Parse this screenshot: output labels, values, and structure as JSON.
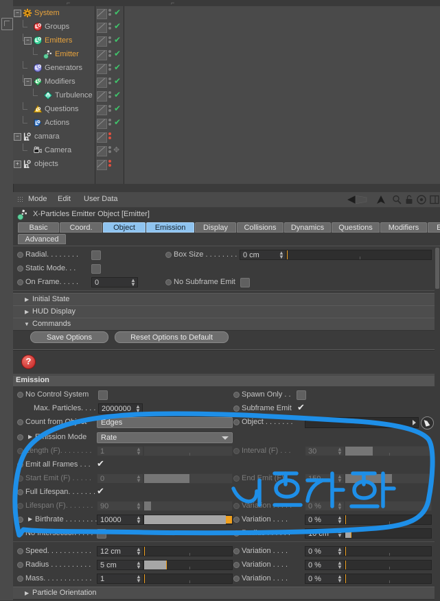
{
  "object_manager": {
    "tree": [
      {
        "label": "System",
        "icon": "gear-icon",
        "color": "orange",
        "depth": 0,
        "expander": "minus",
        "visible_chk": true,
        "dots": "grey"
      },
      {
        "label": "Groups",
        "icon": "group-icon",
        "color": "grey",
        "depth": 1,
        "expander": "none",
        "visible_chk": true,
        "dots": "grey"
      },
      {
        "label": "Emitters",
        "icon": "emitters-icon",
        "color": "orange",
        "depth": 1,
        "expander": "minus",
        "visible_chk": true,
        "dots": "grey"
      },
      {
        "label": "Emitter",
        "icon": "particle-emitter-icon",
        "color": "orange",
        "depth": 2,
        "expander": "none",
        "visible_chk": true,
        "dots": "grey"
      },
      {
        "label": "Generators",
        "icon": "generators-icon",
        "color": "grey",
        "depth": 1,
        "expander": "none",
        "visible_chk": true,
        "dots": "grey"
      },
      {
        "label": "Modifiers",
        "icon": "modifiers-icon",
        "color": "grey",
        "depth": 1,
        "expander": "minus",
        "visible_chk": true,
        "dots": "grey"
      },
      {
        "label": "Turbulence",
        "icon": "turbulence-icon",
        "color": "grey",
        "depth": 2,
        "expander": "none",
        "visible_chk": true,
        "dots": "grey"
      },
      {
        "label": "Questions",
        "icon": "questions-icon",
        "color": "grey",
        "depth": 1,
        "expander": "none",
        "visible_chk": true,
        "dots": "grey"
      },
      {
        "label": "Actions",
        "icon": "actions-icon",
        "color": "grey",
        "depth": 1,
        "expander": "none",
        "visible_chk": true,
        "dots": "grey"
      },
      {
        "label": "camara",
        "icon": "null-object-icon",
        "color": "grey",
        "depth": 0,
        "expander": "minus",
        "visible_chk": false,
        "dots": "red"
      },
      {
        "label": "Camera",
        "icon": "camera-icon",
        "color": "grey",
        "depth": 1,
        "expander": "none",
        "visible_chk": false,
        "dots": "grey"
      },
      {
        "label": "objects",
        "icon": "null-object-icon",
        "color": "grey",
        "depth": 0,
        "expander": "plus",
        "visible_chk": false,
        "dots": "red"
      }
    ]
  },
  "attribute_manager": {
    "menu": [
      "Mode",
      "Edit",
      "User Data"
    ],
    "toolbar_icons": [
      "back-arrow-icon",
      "up-arrow-icon",
      "search-icon",
      "lock-icon",
      "target-icon",
      "panel-icon"
    ],
    "title": "X-Particles Emitter Object [Emitter]",
    "title_icon": "particle-emitter-icon",
    "tabs_row1": [
      "Basic",
      "Coord.",
      "Object",
      "Emission",
      "Display",
      "Collisions",
      "Dynamics",
      "Questions",
      "Modifiers",
      "Editing"
    ],
    "tabs_row2": [
      "Advanced"
    ],
    "selected_tabs": [
      "Object",
      "Emission"
    ]
  },
  "object_tab": {
    "radial": {
      "label": "Radial. . . . . . . .",
      "checked": false
    },
    "static_mode": {
      "label": "Static Mode. . .",
      "checked": false
    },
    "on_frame": {
      "label": "On Frame. . . . .",
      "value": "0"
    },
    "box_size": {
      "label": "Box Size . . . . . . . .",
      "value": "0 cm"
    },
    "no_subframe_emit": {
      "label": "No Subframe Emit",
      "checked": false
    },
    "sections": [
      "Initial State",
      "HUD Display",
      "Commands"
    ],
    "commands": {
      "save_options": "Save Options",
      "reset_options": "Reset Options to Default"
    }
  },
  "emission": {
    "header": "Emission",
    "no_control_system": {
      "label": "No Control System",
      "checked": false
    },
    "max_particles": {
      "label": "Max. Particles. . . . .",
      "value": "2000000"
    },
    "count_from_object": {
      "label": "Count from Object",
      "value": "Edges"
    },
    "spawn_only": {
      "label": "Spawn Only . .",
      "checked": false
    },
    "subframe_emit": {
      "label": "Subframe Emit",
      "checked": true
    },
    "object": {
      "label": "Object . . . . . . .",
      "value": ""
    },
    "emission_mode": {
      "label": "Emission Mode",
      "value": "Rate"
    },
    "length_f": {
      "label": "Length (F). . . . . . . .",
      "value": "1",
      "disabled": true
    },
    "interval_f": {
      "label": "Interval (F) . . .",
      "value": "30",
      "disabled": true
    },
    "emit_all_frames": {
      "label": "Emit all Frames . . .",
      "checked": true
    },
    "start_emit_f": {
      "label": "Start Emit (F) . . . . .",
      "value": "0",
      "disabled": true
    },
    "end_emit_f": {
      "label": "End Emit (F). . .",
      "value": "150",
      "disabled": true
    },
    "full_lifespan": {
      "label": "Full Lifespan. . . . . . .",
      "checked": true
    },
    "lifespan_f": {
      "label": "Lifespan (F). . . . . . .",
      "value": "90",
      "disabled": true
    },
    "lifespan_variation": {
      "label": "Variation . . . . .",
      "value": "0 %",
      "disabled": true
    },
    "birthrate": {
      "label": "Birthrate . . . . . . . .",
      "value": "10000"
    },
    "birthrate_variation": {
      "label": "Variation . . . .",
      "value": "0 %"
    },
    "no_intersection": {
      "label": "No Intersection . . . .",
      "checked": false
    },
    "radius_top": {
      "label": "Radius . . . . . .",
      "value": "10 cm"
    },
    "speed": {
      "label": "Speed. . . . . . . . . . .",
      "value": "12 cm"
    },
    "speed_variation": {
      "label": "Variation . . . .",
      "value": "0 %"
    },
    "radius": {
      "label": "Radius . . . . . . . . . .",
      "value": "5 cm"
    },
    "radius_variation": {
      "label": "Variation . . . .",
      "value": "0 %"
    },
    "mass": {
      "label": "Mass. . . . . . . . . . . .",
      "value": "1"
    },
    "mass_variation": {
      "label": "Variation . . . .",
      "value": "0 %"
    },
    "particle_orientation": "Particle Orientation"
  },
  "annotation": {
    "color": "#1E8FE8",
    "type": "hand-drawn-circle-and-text"
  }
}
